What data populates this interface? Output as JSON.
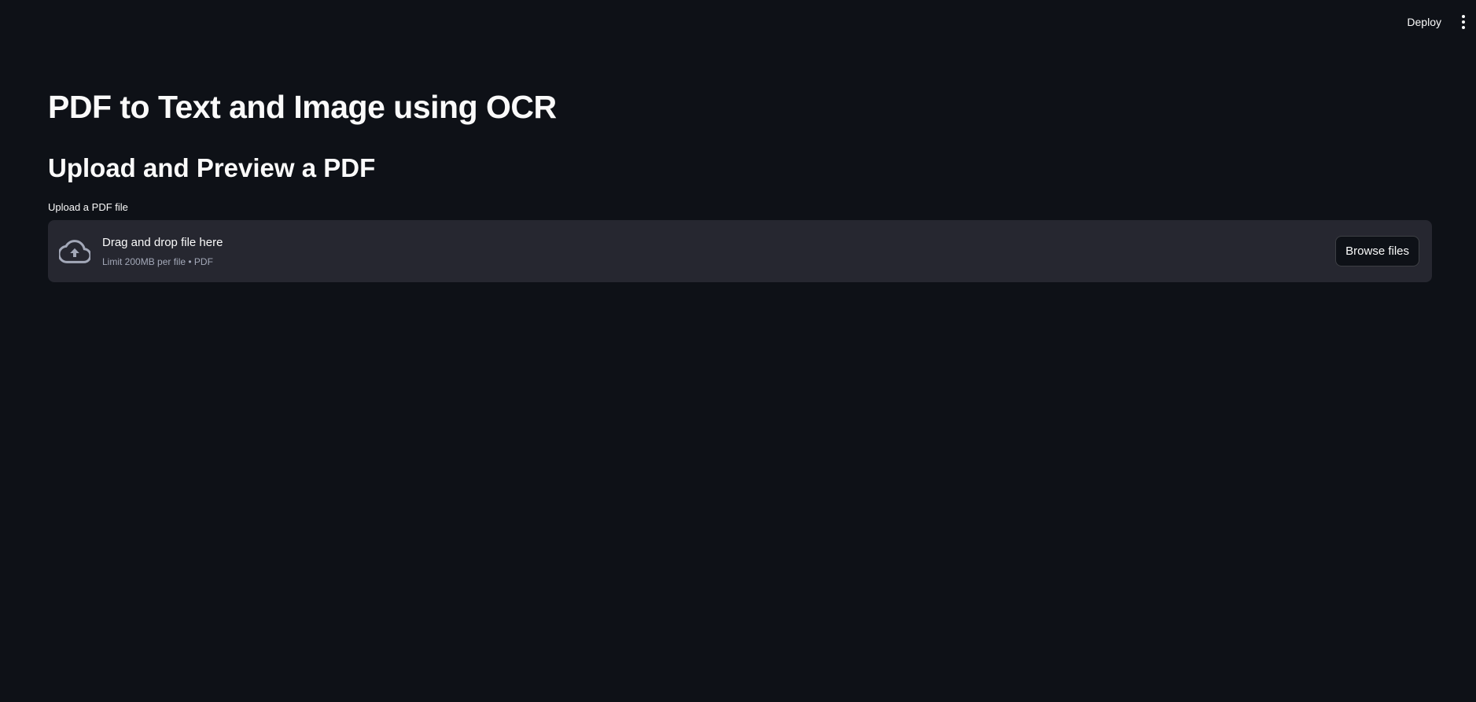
{
  "header": {
    "deploy_label": "Deploy",
    "menu_icon": "vertical-ellipsis-icon"
  },
  "main": {
    "title": "PDF to Text and Image using OCR",
    "subheader": "Upload and Preview a PDF",
    "uploader": {
      "label": "Upload a PDF file",
      "icon": "cloud-upload-icon",
      "instruction": "Drag and drop file here",
      "limit": "Limit 200MB per file • PDF",
      "button_label": "Browse files"
    }
  },
  "colors": {
    "background": "#0e1117",
    "dropzone": "#262730",
    "text": "#fafafa",
    "muted_text": "#a3a8b8"
  }
}
